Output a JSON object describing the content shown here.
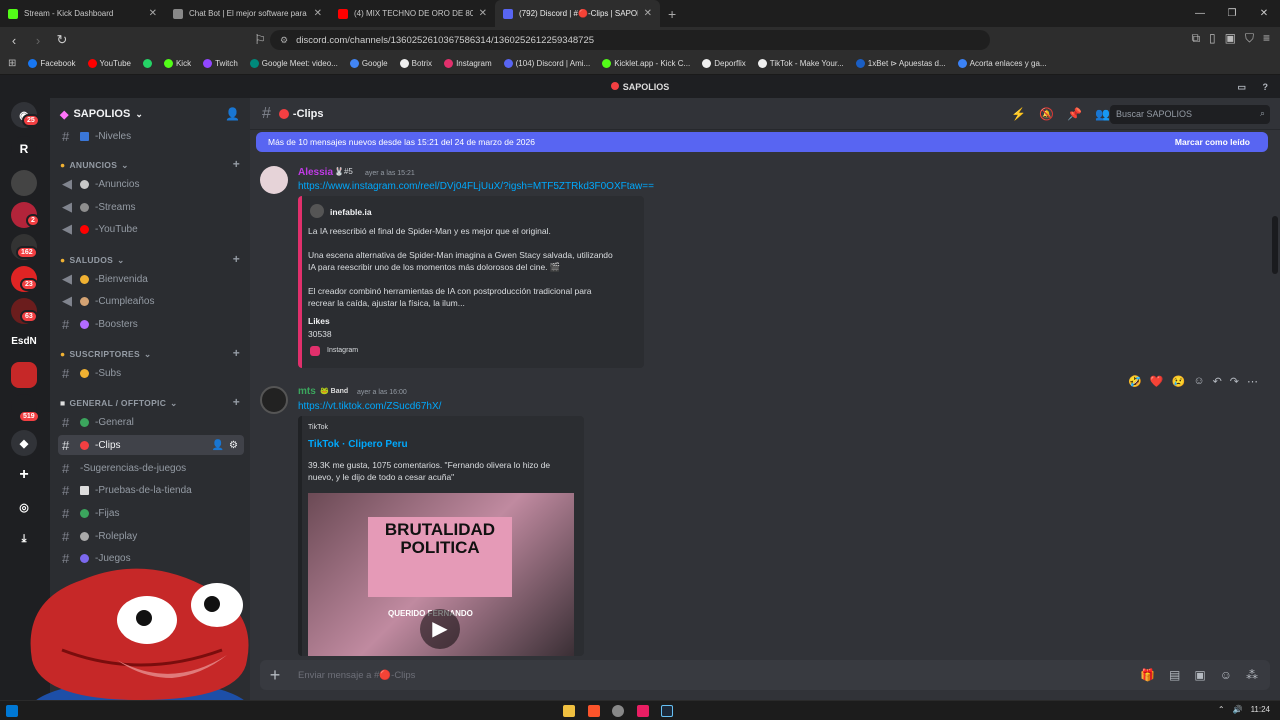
{
  "browser": {
    "tabs": [
      {
        "label": "Stream - Kick Dashboard",
        "color": "#53fc18"
      },
      {
        "label": "Chat Bot | El mejor software para pot",
        "color": "#cccccc"
      },
      {
        "label": "(4) MIX TECHNO DE ORO DE 80's",
        "color": "#ff0000"
      },
      {
        "label": "(792) Discord | #🔴-Clips | SAPOLIO",
        "color": "#5865f2"
      }
    ],
    "new_tab": "+",
    "url": "discord.com/channels/1360252610367586314/1360252612259348725",
    "bookmarks": [
      {
        "label": "Facebook",
        "color": "#1877f2"
      },
      {
        "label": "YouTube",
        "color": "#ff0000"
      },
      {
        "label": "",
        "color": "#25d366"
      },
      {
        "label": "Kick",
        "color": "#53fc18"
      },
      {
        "label": "Twitch",
        "color": "#9146ff"
      },
      {
        "label": "Google Meet: video...",
        "color": "#00897b"
      },
      {
        "label": "Google",
        "color": "#4285f4"
      },
      {
        "label": "Botrix",
        "color": "#ffffff"
      },
      {
        "label": "Instagram",
        "color": "#e1306c"
      },
      {
        "label": "(104) Discord | Ami...",
        "color": "#5865f2"
      },
      {
        "label": "Kicklet.app - Kick C...",
        "color": "#53fc18"
      },
      {
        "label": "Deporflix",
        "color": "#ffffff"
      },
      {
        "label": "TikTok - Make Your...",
        "color": "#ffffff"
      },
      {
        "label": "1xBet ⊳ Apuestas d...",
        "color": "#1a5ec4"
      },
      {
        "label": "Acorta enlaces y ga...",
        "color": "#3b82f6"
      }
    ]
  },
  "discord": {
    "title": "SAPOLIOS",
    "server_badges": [
      "25",
      "2",
      "162",
      "23",
      "63",
      "519"
    ],
    "server_letters": [
      "R",
      "EsdN"
    ],
    "server_name": "SAPOLIOS",
    "categories": [
      {
        "label": "ANUNCIOS"
      },
      {
        "label": "SALUDOS"
      },
      {
        "label": "SUSCRIPTORES"
      },
      {
        "label": "GENERAL / OFFTOPIC"
      }
    ],
    "channels": {
      "niveles": "-Niveles",
      "anuncios": "-Anuncios",
      "streams": "-Streams",
      "youtube": "-YouTube",
      "bienvenida": "-Bienvenida",
      "cumpleanos": "-Cumpleaños",
      "boosters": "-Boosters",
      "subs": "-Subs",
      "general": "-General",
      "clips": "-Clips",
      "sugerencias": "-Sugerencias-de-juegos",
      "pruebas": "-Pruebas-de-la-tienda",
      "fijas": "-Fijas",
      "roleplay": "-Roleplay",
      "juegos": "-Juegos"
    },
    "header": {
      "channel": "-Clips",
      "search_placeholder": "Buscar SAPOLIOS"
    },
    "new_messages": {
      "text": "Más de 10 mensajes nuevos desde las 15:21 del 24 de marzo de 2026",
      "action": "Marcar como leído"
    },
    "messages": [
      {
        "author": "Alessia",
        "author_color": "#c03be6",
        "timestamp": "ayer a las 15:21",
        "link": "https://www.instagram.com/reel/DVj04FLjUuX/?igsh=MTF5ZTRkd3F0OXFtaw==",
        "embed": {
          "provider": "inefable.ia",
          "p1": "La IA reescribió el final de Spider-Man y es mejor que el original.",
          "p2a": "Una escena alternativa de Spider-Man imagina a Gwen Stacy salvada, utilizando",
          "p2b": "IA para reescribir uno de los momentos más dolorosos del cine. 🎬",
          "p3a": "El creador combinó herramientas de IA con postproducción tradicional para",
          "p3b": "recrear la caída, ajustar la física, la ilum...",
          "likes_label": "Likes",
          "likes_value": "30538",
          "footer": "Instagram"
        }
      },
      {
        "author": "mts",
        "author_color": "#3ba55d",
        "tag": "Band",
        "timestamp": "ayer a las 16:00",
        "link": "https://vt.tiktok.com/ZSucd67hX/",
        "embed": {
          "provider": "TikTok",
          "title": "TikTok · Clipero Peru",
          "d1": "39.3K me gusta, 1075 comentarios. \"Fernando olivera lo hizo de",
          "d2": "nuevo, y le dijo de todo a cesar acuña\"",
          "video_text": "BRUTALIDAD POLITICA",
          "video_caption": "QUERIDO FERNANDO"
        }
      }
    ],
    "composer_placeholder": "Enviar mensaje a #🔴-Clips"
  },
  "taskbar": {
    "time": "11:24"
  }
}
